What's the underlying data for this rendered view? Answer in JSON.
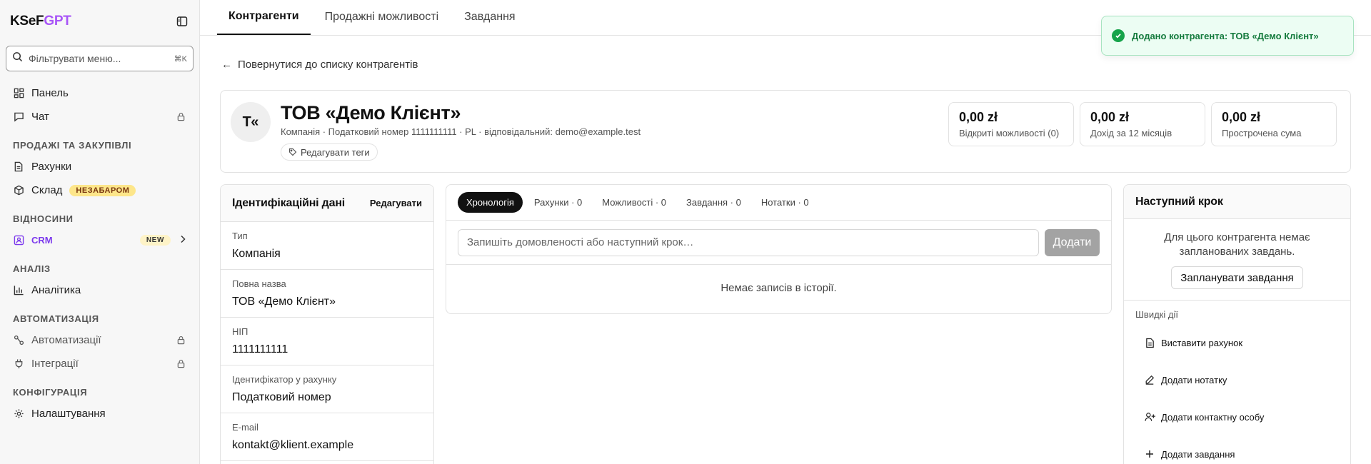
{
  "brand": {
    "prefix": "KSeF",
    "suffix": "GPT"
  },
  "sidebar": {
    "filter_placeholder": "Фільтрувати меню...",
    "filter_shortcut": "⌘K",
    "items_top": [
      {
        "label": "Панель",
        "icon": "dashboard-icon"
      },
      {
        "label": "Чат",
        "icon": "chat-icon",
        "locked": true
      }
    ],
    "sections": [
      {
        "title": "ПРОДАЖІ ТА ЗАКУПІВЛІ"
      },
      {
        "title": "ВІДНОСИНИ"
      },
      {
        "title": "АНАЛІЗ"
      },
      {
        "title": "АВТОМАТИЗАЦІЯ"
      },
      {
        "title": "КОНФІГУРАЦІЯ"
      }
    ],
    "items": {
      "invoices": "Рахунки",
      "warehouse": "Склад",
      "warehouse_badge": "НЕЗАБАРОМ",
      "crm": "CRM",
      "crm_badge": "NEW",
      "analytics": "Аналітика",
      "automations": "Автоматизації",
      "integrations": "Інтеграції",
      "settings": "Налаштування"
    }
  },
  "tabs": [
    {
      "label": "Контрагенти",
      "active": true
    },
    {
      "label": "Продажні можливості",
      "active": false
    },
    {
      "label": "Завдання",
      "active": false
    }
  ],
  "toast": {
    "message": "Додано контрагента: ТОВ «Демо Клієнт»",
    "color": "#16a34a"
  },
  "back_link": "Повернутися до списку контрагентів",
  "contractor": {
    "initials": "Т«",
    "name": "ТОВ «Демо Клієнт»",
    "meta": "Компанія · Податковий номер 1111111111 · PL · відповідальний: demo@example.test",
    "edit_tags": "Редагувати теги"
  },
  "stats": [
    {
      "value": "0,00 zł",
      "label": "Відкриті можливості (0)"
    },
    {
      "value": "0,00 zł",
      "label": "Дохід за 12 місяців"
    },
    {
      "value": "0,00 zł",
      "label": "Прострочена сума"
    }
  ],
  "identification": {
    "title": "Ідентифікаційні дані",
    "edit": "Редагувати",
    "fields": [
      {
        "label": "Тип",
        "value": "Компанія"
      },
      {
        "label": "Повна назва",
        "value": "ТОВ «Демо Клієнт»"
      },
      {
        "label": "НІП",
        "value": "1111111111"
      },
      {
        "label": "Ідентифікатор у рахунку",
        "value": "Податковий номер"
      },
      {
        "label": "E-mail",
        "value": "kontakt@klient.example"
      }
    ]
  },
  "timeline": {
    "pills": [
      "Хронологія",
      "Рахунки · 0",
      "Можливості · 0",
      "Завдання · 0",
      "Нотатки · 0"
    ],
    "input_placeholder": "Запишіть домовленості або наступний крок…",
    "add_button": "Додати",
    "empty": "Немає записів в історії."
  },
  "next_step": {
    "title": "Наступний крок",
    "empty_line1": "Для цього контрагента немає",
    "empty_line2": "запланованих завдань.",
    "plan_button": "Запланувати завдання",
    "quick_title": "Швидкі дії",
    "actions": [
      {
        "label": "Виставити рахунок",
        "icon": "document-icon"
      },
      {
        "label": "Додати нотатку",
        "icon": "pencil-icon"
      },
      {
        "label": "Додати контактну особу",
        "icon": "user-plus-icon"
      },
      {
        "label": "Додати завдання",
        "icon": "plus-icon"
      }
    ]
  }
}
